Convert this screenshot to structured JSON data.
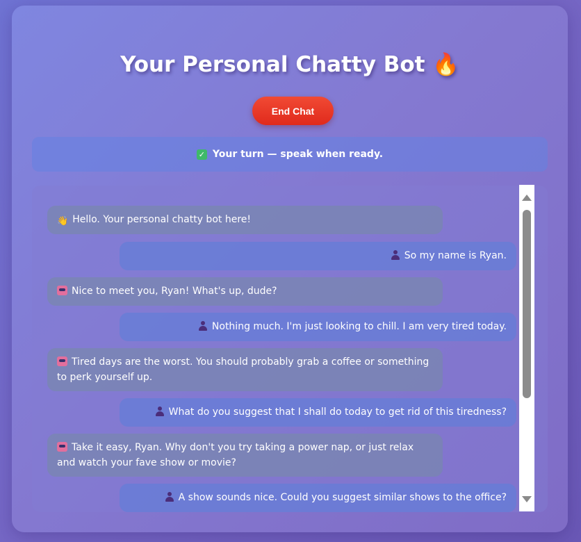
{
  "header": {
    "title": "Your Personal Chatty Bot 🔥"
  },
  "controls": {
    "end_chat_label": "End Chat"
  },
  "status": {
    "icon": "check-icon",
    "text": "Your turn — speak when ready."
  },
  "chat": {
    "messages": [
      {
        "sender": "bot",
        "icon": "wave-icon",
        "text": "Hello. Your personal chatty bot here!"
      },
      {
        "sender": "user",
        "icon": "user-icon",
        "text": "So my name is Ryan."
      },
      {
        "sender": "bot",
        "icon": "robot-icon",
        "text": "Nice to meet you, Ryan! What's up, dude?"
      },
      {
        "sender": "user",
        "icon": "user-icon",
        "text": "Nothing much. I'm just looking to chill. I am very tired today."
      },
      {
        "sender": "bot",
        "icon": "robot-icon",
        "text": "Tired days are the worst. You should probably grab a coffee or something to perk yourself up."
      },
      {
        "sender": "user",
        "icon": "user-icon",
        "text": "What do you suggest that I shall do today to get rid of this tiredness?"
      },
      {
        "sender": "bot",
        "icon": "robot-icon",
        "text": "Take it easy, Ryan. Why don't you try taking a power nap, or just relax and watch your fave show or movie?"
      },
      {
        "sender": "user",
        "icon": "user-icon",
        "text": "A show sounds nice. Could you suggest similar shows to the office?"
      }
    ]
  },
  "colors": {
    "end_button": "#e8331f",
    "status_check": "#3fb96a"
  }
}
